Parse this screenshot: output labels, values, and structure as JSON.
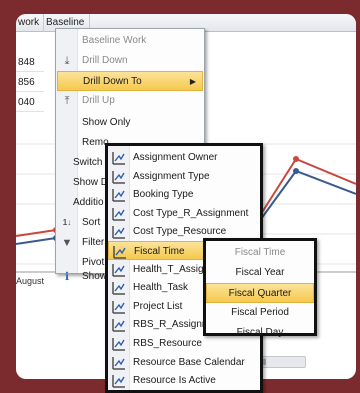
{
  "grid": {
    "columns": [
      "Work",
      "Baseline"
    ],
    "column_prefix_cut": "work",
    "values": [
      "848",
      "856",
      "040"
    ]
  },
  "chart": {
    "axis_label": "August",
    "colors": {
      "series_a": "#c8473f",
      "series_b": "#3a5a8c"
    }
  },
  "context_menu": {
    "items": [
      {
        "label": "Baseline Work",
        "state": "header",
        "icon": ""
      },
      {
        "label": "Drill Down",
        "state": "disabled",
        "icon": "drill-down-icon"
      },
      {
        "label": "Drill Down To",
        "state": "highlight",
        "icon": "",
        "submenu": true
      },
      {
        "label": "Drill Up",
        "state": "disabled",
        "icon": "drill-up-icon"
      },
      {
        "label": "Show Only",
        "state": "normal",
        "icon": ""
      },
      {
        "label": "Remo",
        "state": "normal",
        "icon": ""
      },
      {
        "label": "Switch",
        "state": "normal",
        "icon": ""
      },
      {
        "label": "Show D",
        "state": "normal",
        "icon": ""
      },
      {
        "label": "Additio",
        "state": "normal",
        "icon": ""
      },
      {
        "label": "Sort",
        "state": "normal",
        "icon": "sort-icon"
      },
      {
        "label": "Filter",
        "state": "normal",
        "icon": "filter-icon"
      },
      {
        "label": "Pivot",
        "state": "normal",
        "icon": ""
      },
      {
        "label": "Show In",
        "state": "normal",
        "icon": "info-icon"
      }
    ]
  },
  "dimension_menu": {
    "items": [
      {
        "label": "Assignment Owner",
        "highlight": false
      },
      {
        "label": "Assignment Type",
        "highlight": false
      },
      {
        "label": "Booking Type",
        "highlight": false
      },
      {
        "label": "Cost Type_R_Assignment",
        "highlight": false
      },
      {
        "label": "Cost Type_Resource",
        "highlight": false
      },
      {
        "label": "Fiscal Time",
        "highlight": true
      },
      {
        "label": "Health_T_Assign",
        "highlight": false
      },
      {
        "label": "Health_Task",
        "highlight": false
      },
      {
        "label": "Project List",
        "highlight": false
      },
      {
        "label": "RBS_R_Assignme",
        "highlight": false
      },
      {
        "label": "RBS_Resource",
        "highlight": false
      },
      {
        "label": "Resource Base Calendar",
        "highlight": false
      },
      {
        "label": "Resource Is Active",
        "highlight": false
      }
    ]
  },
  "fiscal_menu": {
    "header": "Fiscal Time",
    "items": [
      {
        "label": "Fiscal Year",
        "highlight": false
      },
      {
        "label": "Fiscal Quarter",
        "highlight": true
      },
      {
        "label": "Fiscal Period",
        "highlight": false
      },
      {
        "label": "Fiscal Day",
        "highlight": false
      }
    ]
  },
  "scrollbar": {
    "grip": "⦀"
  }
}
